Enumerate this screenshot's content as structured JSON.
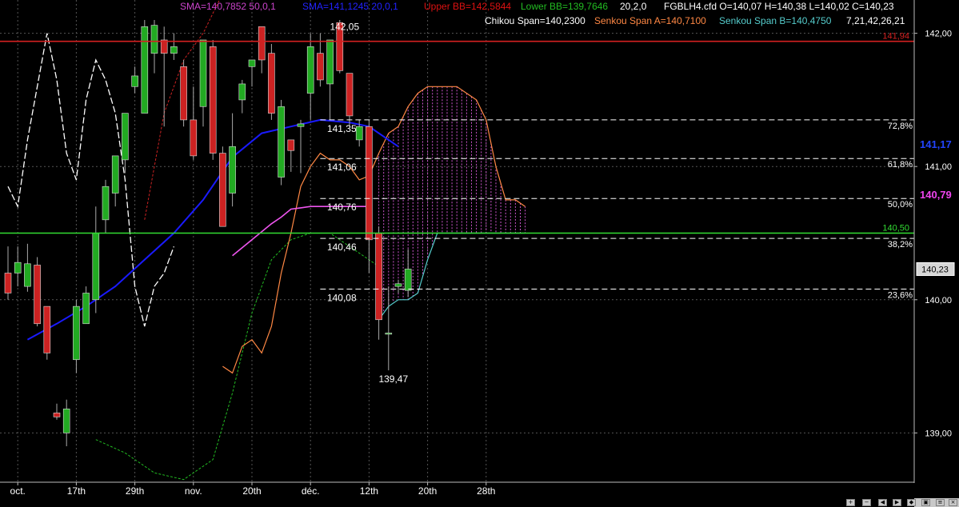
{
  "chart_data": {
    "type": "candlestick",
    "instrument": "FGBLH4.cfd",
    "ohlc_label": "O=140,07 H=140,38 L=140,02 C=140,23",
    "header": {
      "sma1": {
        "text": "SMA=140,7852  50,0,1",
        "color": "#cc44cc"
      },
      "sma2": {
        "text": "SMA=141,1245  20,0,1",
        "color": "#2222ff"
      },
      "upper_bb": {
        "text": "Upper BB=142,5844",
        "color": "#dd1111"
      },
      "lower_bb": {
        "text": "Lower BB=139,7646",
        "color": "#22bb22"
      },
      "bb_params": {
        "text": "20,2,0",
        "color": "#ffffff"
      },
      "chikou": {
        "text": "Chikou Span=140,2300",
        "color": "#ffffff"
      },
      "senkou_a": {
        "text": "Senkou Span A=140,7100",
        "color": "#ff8844"
      },
      "senkou_b": {
        "text": "Senkou Span B=140,4750",
        "color": "#55cccc"
      },
      "ichimoku_params": {
        "text": "7,21,42,26,21",
        "color": "#ffffff"
      }
    },
    "y_axis": {
      "min": 138.63,
      "max": 142.25,
      "ticks": [
        {
          "v": 142.0,
          "label": "142,00"
        },
        {
          "v": 141.0,
          "label": "141,00"
        },
        {
          "v": 140.0,
          "label": "140,00"
        },
        {
          "v": 139.0,
          "label": "139,00"
        }
      ]
    },
    "x_axis": {
      "slots": 82,
      "labels": [
        {
          "i": 1,
          "label": "oct."
        },
        {
          "i": 7,
          "label": "17th"
        },
        {
          "i": 13,
          "label": "29th"
        },
        {
          "i": 19,
          "label": "nov."
        },
        {
          "i": 25,
          "label": "20th"
        },
        {
          "i": 31,
          "label": "déc."
        },
        {
          "i": 37,
          "label": "12th"
        },
        {
          "i": 43,
          "label": "20th"
        },
        {
          "i": 49,
          "label": "28th"
        }
      ]
    },
    "candles": [
      [
        140.2,
        140.4,
        140.0,
        140.05
      ],
      [
        140.2,
        140.4,
        140.1,
        140.28
      ],
      [
        140.1,
        140.42,
        140.06,
        140.27
      ],
      [
        140.26,
        140.32,
        139.8,
        139.82
      ],
      [
        139.95,
        139.95,
        139.55,
        139.6
      ],
      [
        139.15,
        139.22,
        139.1,
        139.12
      ],
      [
        139.0,
        139.25,
        138.9,
        139.18
      ],
      [
        139.55,
        140.0,
        139.45,
        139.95
      ],
      [
        139.82,
        140.1,
        139.82,
        140.05
      ],
      [
        140.0,
        140.7,
        139.9,
        140.5
      ],
      [
        140.6,
        140.9,
        140.5,
        140.85
      ],
      [
        140.8,
        141.0,
        140.7,
        141.08
      ],
      [
        141.05,
        141.32,
        140.95,
        141.4
      ],
      [
        141.6,
        141.75,
        141.55,
        141.68
      ],
      [
        141.4,
        142.1,
        141.4,
        142.05
      ],
      [
        141.85,
        142.1,
        141.7,
        142.06
      ],
      [
        141.95,
        142.05,
        141.3,
        141.85
      ],
      [
        141.85,
        142.0,
        141.8,
        141.9
      ],
      [
        141.75,
        141.8,
        141.3,
        141.35
      ],
      [
        141.35,
        141.6,
        141.05,
        141.08
      ],
      [
        141.45,
        141.95,
        141.3,
        141.95
      ],
      [
        141.9,
        141.95,
        141.05,
        141.1
      ],
      [
        141.1,
        141.15,
        140.55,
        140.55
      ],
      [
        140.8,
        141.4,
        140.7,
        141.15
      ],
      [
        141.5,
        141.65,
        141.4,
        141.62
      ],
      [
        141.75,
        141.8,
        141.6,
        141.8
      ],
      [
        142.05,
        142.05,
        141.7,
        141.8
      ],
      [
        141.85,
        141.92,
        141.35,
        141.4
      ],
      [
        140.92,
        141.5,
        140.86,
        141.45
      ],
      [
        141.2,
        141.2,
        140.96,
        141.12
      ],
      [
        141.3,
        141.35,
        140.95,
        141.32
      ],
      [
        141.55,
        142.0,
        141.35,
        141.9
      ],
      [
        141.85,
        142.0,
        141.6,
        141.65
      ],
      [
        141.62,
        141.95,
        141.35,
        141.95
      ],
      [
        142.08,
        142.1,
        141.7,
        141.72
      ],
      [
        141.7,
        141.7,
        141.3,
        141.38
      ],
      [
        141.2,
        141.35,
        141.15,
        141.3
      ],
      [
        141.3,
        141.35,
        140.2,
        140.45
      ],
      [
        140.5,
        140.55,
        139.7,
        139.85
      ],
      [
        139.75,
        140.1,
        139.47,
        139.75
      ],
      [
        140.1,
        140.15,
        140.05,
        140.12
      ],
      [
        140.07,
        140.38,
        140.02,
        140.23
      ]
    ],
    "candle_start": 0,
    "sma50": [
      [
        2,
        139.7
      ],
      [
        5,
        139.82
      ],
      [
        8,
        139.95
      ],
      [
        11,
        140.1
      ],
      [
        14,
        140.3
      ],
      [
        17,
        140.5
      ],
      [
        20,
        140.75
      ],
      [
        23,
        141.07
      ],
      [
        26,
        141.25
      ],
      [
        29,
        141.3
      ],
      [
        32,
        141.35
      ],
      [
        35,
        141.33
      ],
      [
        37,
        141.3
      ],
      [
        39,
        141.2
      ],
      [
        40,
        141.15
      ]
    ],
    "sma20_line": [
      [
        23,
        140.33
      ],
      [
        25,
        140.45
      ],
      [
        27,
        140.57
      ],
      [
        28,
        140.62
      ],
      [
        29,
        140.68
      ],
      [
        30,
        140.69
      ],
      [
        31,
        140.7
      ],
      [
        33,
        140.7
      ],
      [
        35,
        140.7
      ],
      [
        37,
        140.7
      ]
    ],
    "upper_bb": [
      [
        14,
        140.6
      ],
      [
        15,
        141.0
      ],
      [
        16,
        141.4
      ],
      [
        18,
        141.8
      ],
      [
        20,
        142.0
      ],
      [
        22,
        142.3
      ],
      [
        24,
        142.6
      ],
      [
        26,
        142.55
      ],
      [
        28,
        142.55
      ],
      [
        30,
        142.65
      ],
      [
        32,
        142.75
      ],
      [
        35,
        142.7
      ],
      [
        38,
        142.55
      ]
    ],
    "lower_bb": [
      [
        9,
        138.95
      ],
      [
        12,
        138.85
      ],
      [
        15,
        138.7
      ],
      [
        18,
        138.65
      ],
      [
        21,
        138.8
      ],
      [
        23,
        139.3
      ],
      [
        25,
        139.9
      ],
      [
        27,
        140.3
      ],
      [
        29,
        140.45
      ],
      [
        31,
        140.5
      ],
      [
        33,
        140.5
      ],
      [
        35,
        140.4
      ],
      [
        38,
        140.25
      ]
    ],
    "chikou": [
      [
        0,
        140.85
      ],
      [
        1,
        140.7
      ],
      [
        2,
        141.2
      ],
      [
        3,
        141.6
      ],
      [
        4,
        142.0
      ],
      [
        5,
        141.65
      ],
      [
        6,
        141.1
      ],
      [
        7,
        140.9
      ],
      [
        8,
        141.5
      ],
      [
        9,
        141.8
      ],
      [
        10,
        141.65
      ],
      [
        11,
        141.4
      ],
      [
        12,
        140.9
      ],
      [
        13,
        140.1
      ],
      [
        14,
        139.8
      ],
      [
        15,
        140.1
      ],
      [
        16,
        140.2
      ],
      [
        17,
        140.4
      ]
    ],
    "senkou_a": [
      [
        22,
        139.5
      ],
      [
        23,
        139.45
      ],
      [
        24,
        139.65
      ],
      [
        25,
        139.7
      ],
      [
        26,
        139.6
      ],
      [
        27,
        139.8
      ],
      [
        28,
        140.2
      ],
      [
        29,
        140.5
      ],
      [
        30,
        140.85
      ],
      [
        31,
        141.0
      ],
      [
        32,
        141.1
      ],
      [
        33,
        141.05
      ],
      [
        34,
        141.05
      ],
      [
        35,
        141.0
      ],
      [
        36,
        140.9
      ],
      [
        37,
        140.93
      ],
      [
        38,
        141.1
      ],
      [
        39,
        141.25
      ],
      [
        40,
        141.3
      ],
      [
        41,
        141.45
      ],
      [
        42,
        141.55
      ],
      [
        43,
        141.6
      ],
      [
        44,
        141.6
      ],
      [
        45,
        141.6
      ],
      [
        46,
        141.6
      ],
      [
        47,
        141.55
      ],
      [
        48,
        141.5
      ],
      [
        49,
        141.35
      ],
      [
        50,
        141.0
      ],
      [
        51,
        140.75
      ],
      [
        52,
        140.75
      ],
      [
        53,
        140.7
      ]
    ],
    "senkou_b": [
      [
        38,
        139.85
      ],
      [
        39,
        139.95
      ],
      [
        40,
        140.0
      ],
      [
        41,
        140.0
      ],
      [
        42,
        140.05
      ],
      [
        43,
        140.3
      ],
      [
        44,
        140.5
      ],
      [
        45,
        140.5
      ],
      [
        46,
        140.5
      ],
      [
        47,
        140.5
      ],
      [
        48,
        140.5
      ],
      [
        49,
        140.5
      ],
      [
        50,
        140.5
      ],
      [
        51,
        140.5
      ],
      [
        52,
        140.5
      ],
      [
        53,
        140.5
      ]
    ],
    "h_lines": [
      {
        "v": 141.94,
        "label": "141,94",
        "color": "#d42020",
        "label_color": "#d42020",
        "style": "solid"
      },
      {
        "v": 140.5,
        "label": "140,50",
        "color": "#33dd33",
        "label_color": "#33dd33",
        "style": "solid"
      }
    ],
    "fib_lines": [
      {
        "v": 141.35,
        "label": "141,35",
        "pct": "72,8%"
      },
      {
        "v": 141.06,
        "label": "141,06",
        "pct": "61,8%"
      },
      {
        "v": 140.76,
        "label": "140,76",
        "pct": "50,0%"
      },
      {
        "v": 140.46,
        "label": "140,46",
        "pct": "38,2%"
      },
      {
        "v": 140.08,
        "label": "140,08",
        "pct": "23,6%"
      }
    ],
    "price_tags": [
      {
        "v": 141.17,
        "label": "141,17",
        "color": "#2244ff",
        "kind": "text"
      },
      {
        "v": 140.79,
        "label": "140,79",
        "color": "#ee44ee",
        "kind": "text"
      },
      {
        "v": 140.23,
        "label": "140,23",
        "color": "#000000",
        "kind": "box"
      }
    ],
    "annotations": [
      {
        "v": 142.05,
        "i": 34,
        "label": "142,05"
      },
      {
        "v": 139.47,
        "i": 39,
        "label": "139,47"
      }
    ],
    "colors": {
      "up": "#22aa22",
      "down": "#cc2222",
      "background": "#000000",
      "grid": "#555555"
    }
  }
}
